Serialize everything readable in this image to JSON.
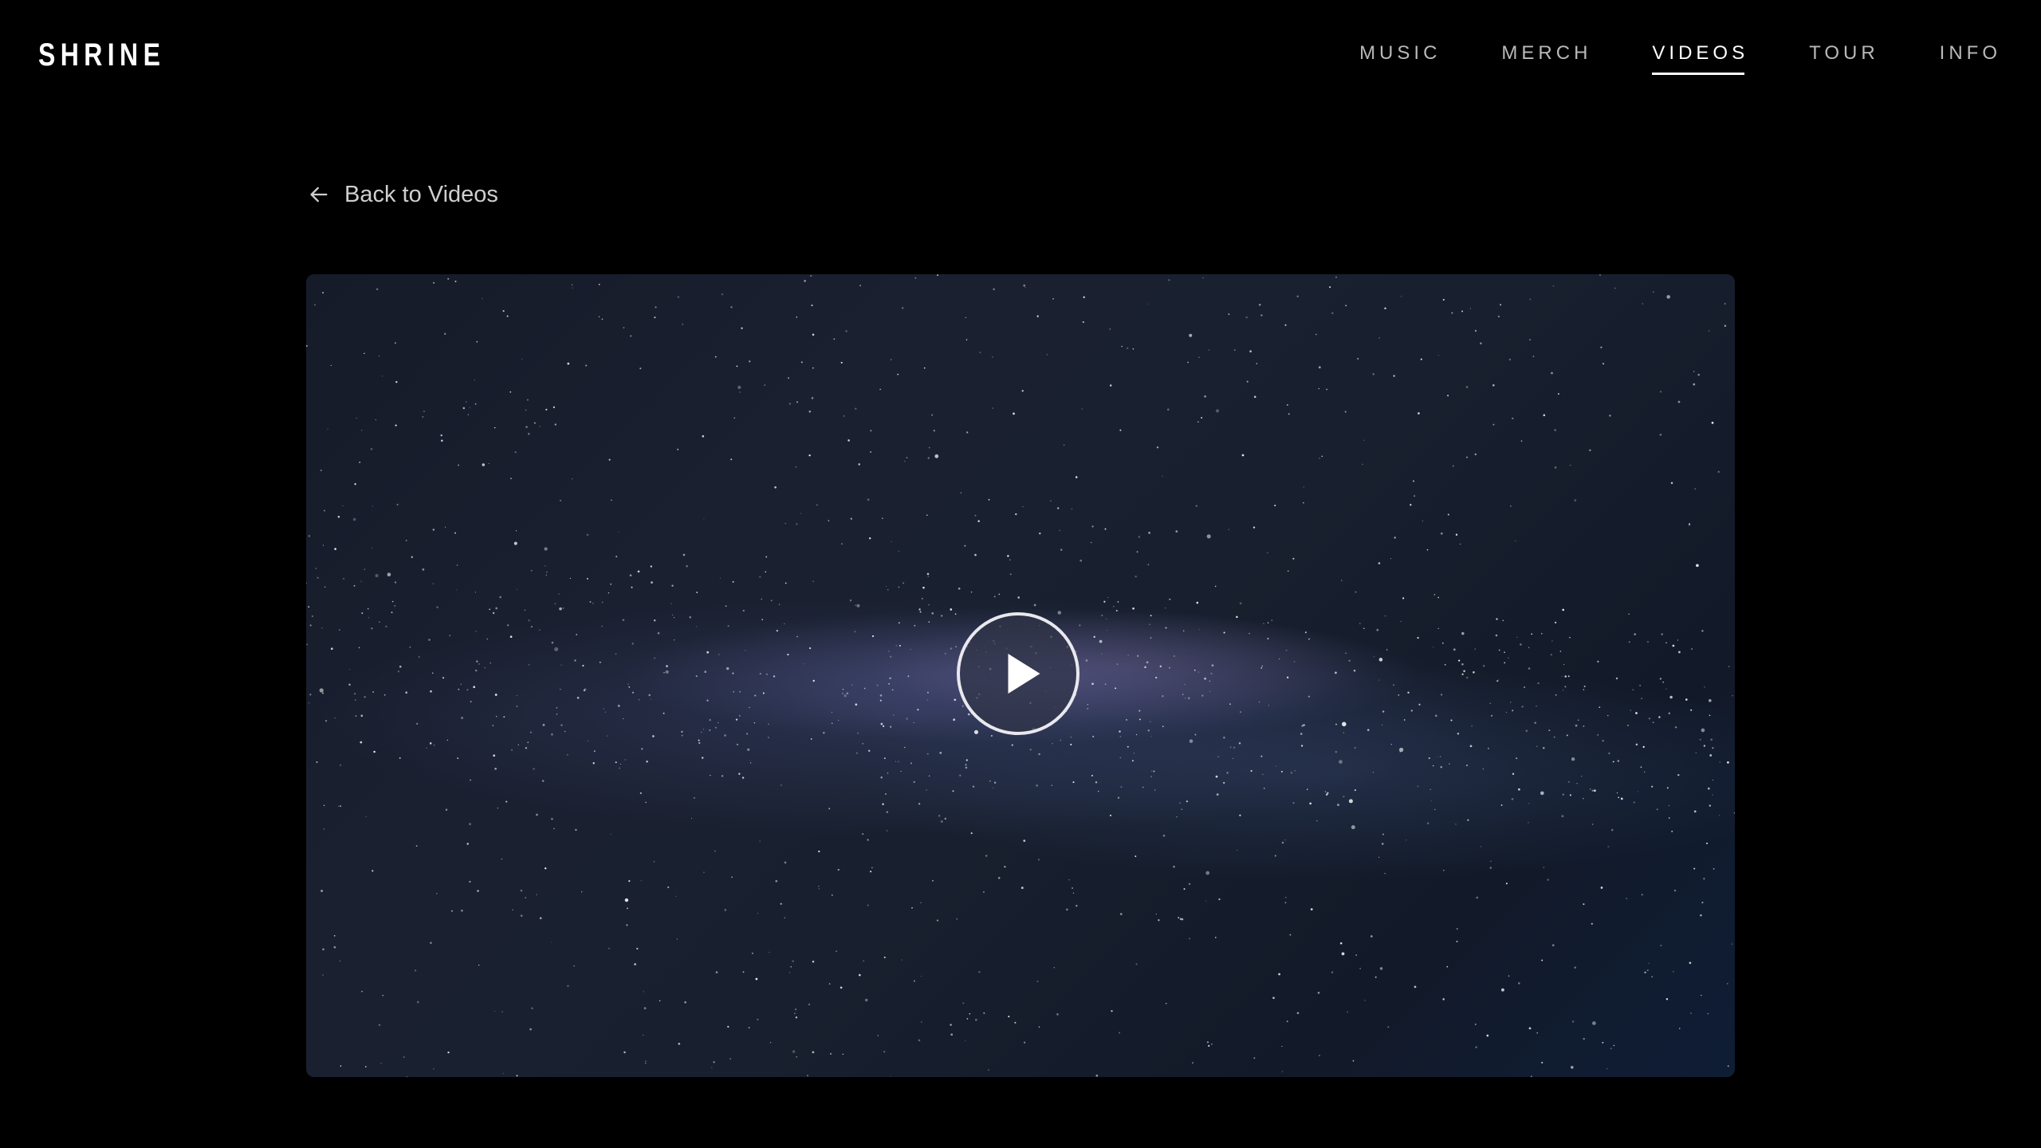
{
  "header": {
    "logo": "SHRINE",
    "nav": [
      {
        "label": "MUSIC",
        "active": false
      },
      {
        "label": "MERCH",
        "active": false
      },
      {
        "label": "VIDEOS",
        "active": true
      },
      {
        "label": "TOUR",
        "active": false
      },
      {
        "label": "INFO",
        "active": false
      }
    ]
  },
  "main": {
    "back_label": "Back to Videos"
  },
  "icons": {
    "back": "arrow-left-icon",
    "play": "play-icon"
  },
  "colors": {
    "background": "#000000",
    "nav_inactive": "#b9b9b9",
    "nav_active": "#ffffff"
  }
}
